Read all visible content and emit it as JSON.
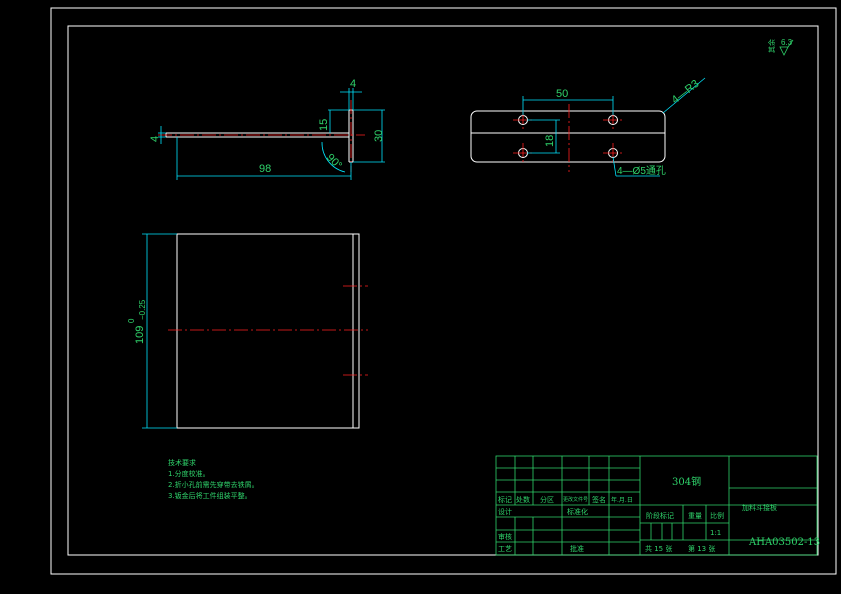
{
  "dimensions": {
    "top_thickness": "4",
    "side_height": "15",
    "overall_height": "30",
    "length": "98",
    "angle": "90°",
    "left_thickness": "4",
    "hole_spacing": "50",
    "corner_radius": "4—R3",
    "hole_vertical": "18",
    "hole_callout": "4—Ø5通孔",
    "width_dim": "109",
    "tol_upper": "0",
    "tol_lower": "−0.25"
  },
  "roughness": {
    "value": "6.3",
    "label": "其余"
  },
  "notes": {
    "heading": "技术要求",
    "items": [
      "1.分度校准。",
      "2.折小孔前需先穿带去铁屑。",
      "3.钣金后将工件组装平整。"
    ]
  },
  "title_block": {
    "material": "304钢",
    "part_name": "加料斗接板",
    "drawing_number": "AHA03502-13",
    "scale": "1:1",
    "sheets_total": "共  15 张",
    "sheet_no": "第 13 张",
    "labels": {
      "mark": "标记",
      "count": "处数",
      "zone": "分区",
      "change_doc": "更改文件号",
      "sign": "签名",
      "date": "年.月.日",
      "design": "设计",
      "standardize": "标准化",
      "stage_mark": "阶段标记",
      "weight": "重量",
      "scale_label": "比例",
      "review": "审核",
      "process": "工艺",
      "approve": "批准"
    }
  }
}
